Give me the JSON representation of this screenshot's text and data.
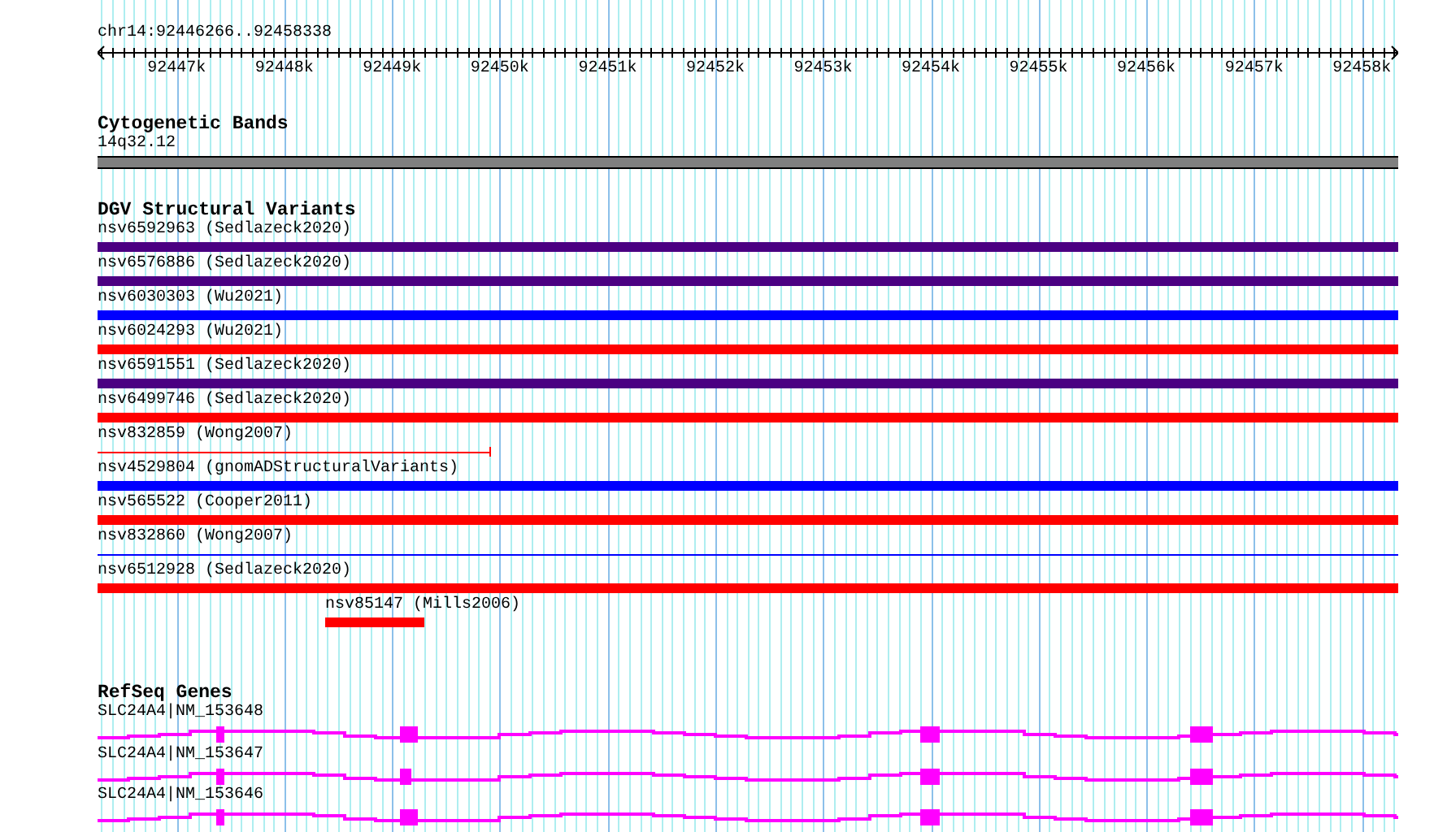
{
  "view": {
    "locus": "chr14:92446266..92458338"
  },
  "ruler": {
    "ticks": [
      "92447k",
      "92448k",
      "92449k",
      "92450k",
      "92451k",
      "92452k",
      "92453k",
      "92454k",
      "92455k",
      "92456k",
      "92457k",
      "92458k"
    ]
  },
  "tracks": [
    {
      "kind": "bands",
      "title": "Cytogenetic Bands",
      "features": [
        {
          "label": "14q32.12"
        }
      ]
    },
    {
      "kind": "variants",
      "title": "DGV Structural Variants",
      "features": [
        {
          "label": "nsv6592963 (Sedlazeck2020)",
          "color": "#4b0082",
          "kind": "bar"
        },
        {
          "label": "nsv6576886 (Sedlazeck2020)",
          "color": "#4b0082",
          "kind": "bar"
        },
        {
          "label": "nsv6030303 (Wu2021)",
          "color": "#0000ff",
          "kind": "bar"
        },
        {
          "label": "nsv6024293 (Wu2021)",
          "color": "#ff0000",
          "kind": "bar"
        },
        {
          "label": "nsv6591551 (Sedlazeck2020)",
          "color": "#4b0082",
          "kind": "bar"
        },
        {
          "label": "nsv6499746 (Sedlazeck2020)",
          "color": "#ff0000",
          "kind": "bar"
        },
        {
          "label": "nsv832859 (Wong2007)",
          "color": "#ff0000",
          "kind": "line"
        },
        {
          "label": "nsv4529804 (gnomADStructuralVariants)",
          "color": "#0000ff",
          "kind": "bar"
        },
        {
          "label": "nsv565522 (Cooper2011)",
          "color": "#ff0000",
          "kind": "bar"
        },
        {
          "label": "nsv832860 (Wong2007)",
          "color": "#0000ff",
          "kind": "line"
        },
        {
          "label": "nsv6512928 (Sedlazeck2020)",
          "color": "#ff0000",
          "kind": "bar"
        },
        {
          "label": "nsv85147 (Mills2006)",
          "color": "#ff0000",
          "kind": "bar"
        }
      ]
    },
    {
      "kind": "genes",
      "title": "RefSeq Genes",
      "features": [
        {
          "label": "SLC24A4|NM_153648"
        },
        {
          "label": "SLC24A4|NM_153647"
        },
        {
          "label": "SLC24A4|NM_153646"
        }
      ]
    }
  ]
}
